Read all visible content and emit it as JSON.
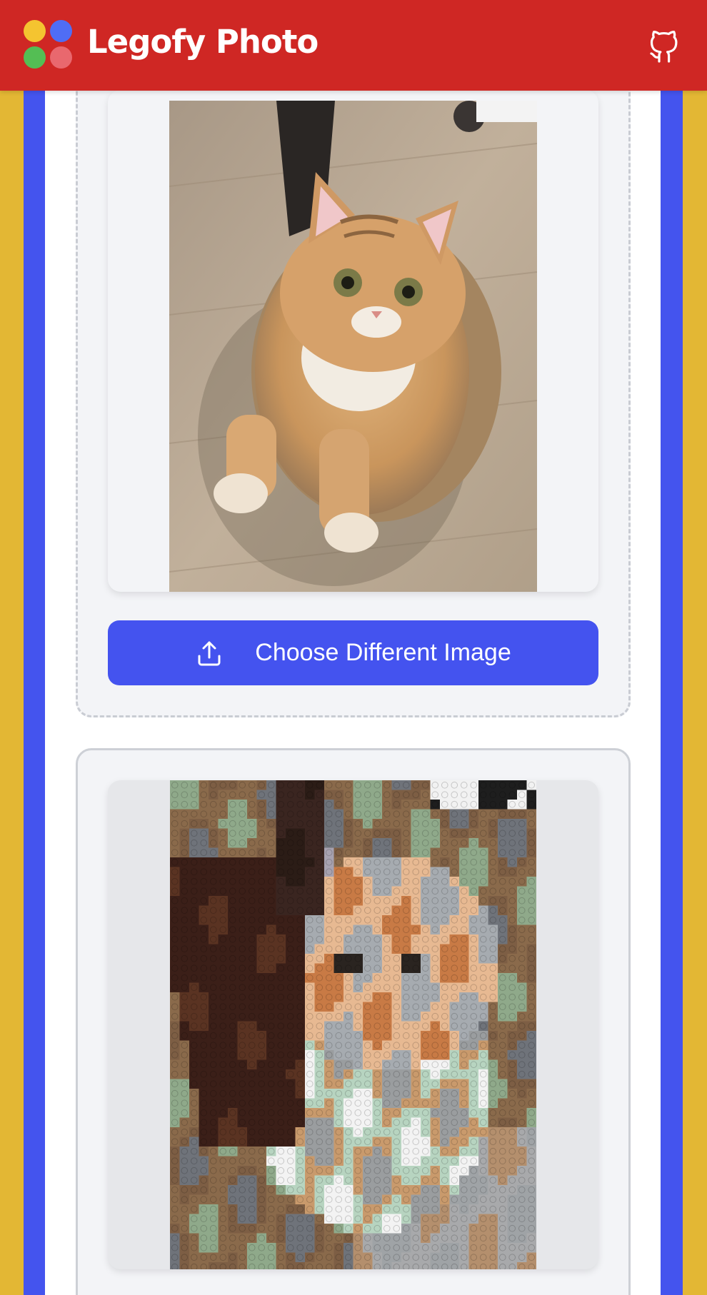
{
  "app": {
    "title": "Legofy Photo"
  },
  "header": {
    "logo_colors": [
      "#f4c430",
      "#4f6df5",
      "#54be54",
      "#e9686e"
    ],
    "github_icon": "github-icon"
  },
  "upload": {
    "button_label": "Choose Different Image",
    "button_icon": "upload-icon"
  },
  "colors": {
    "header_bg": "#cf2724",
    "page_bg": "#e3b734",
    "band_blue": "#4454ee",
    "button_bg": "#4453ef"
  }
}
